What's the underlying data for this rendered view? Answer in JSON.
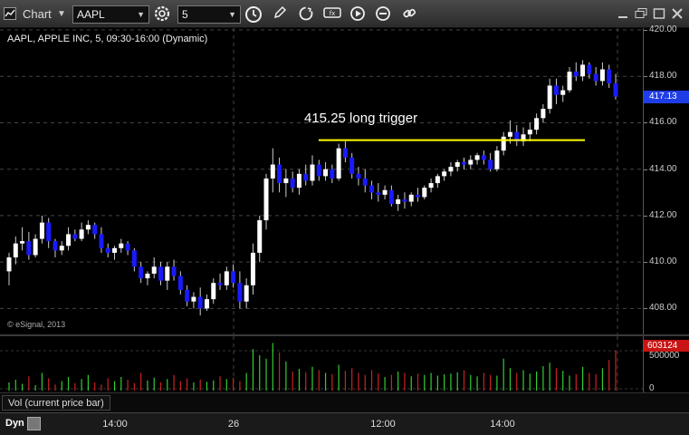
{
  "toolbar": {
    "app_title": "Chart",
    "symbol": "AAPL",
    "interval": "5"
  },
  "chart": {
    "symbol_title": "AAPL, APPLE INC, 5, 09:30-16:00 (Dynamic)",
    "copyright": "© eSignal, 2013",
    "annotation": "415.25 long trigger",
    "trigger_price": 415.25,
    "last_price": "417.13",
    "price_ticks": [
      "420.00",
      "418.00",
      "416.00",
      "414.00",
      "412.00",
      "410.00",
      "408.00"
    ],
    "colors": {
      "up": "#ffffff",
      "down": "#1a1aff",
      "trigger": "#ffff00",
      "wick": "#cccccc"
    },
    "candles": [
      [
        409.6,
        410.4,
        409.0,
        410.2
      ],
      [
        410.2,
        411.1,
        409.9,
        410.8
      ],
      [
        410.8,
        411.5,
        410.5,
        410.9
      ],
      [
        410.9,
        411.3,
        410.1,
        410.3
      ],
      [
        410.3,
        411.2,
        410.2,
        411.0
      ],
      [
        411.0,
        412.0,
        410.8,
        411.7
      ],
      [
        411.7,
        411.9,
        410.6,
        410.9
      ],
      [
        410.9,
        411.0,
        410.2,
        410.5
      ],
      [
        410.5,
        410.9,
        410.3,
        410.7
      ],
      [
        410.7,
        411.5,
        410.5,
        411.2
      ],
      [
        411.2,
        411.4,
        410.9,
        411.0
      ],
      [
        411.0,
        411.7,
        410.9,
        411.4
      ],
      [
        411.4,
        411.8,
        411.2,
        411.6
      ],
      [
        411.6,
        411.7,
        411.0,
        411.2
      ],
      [
        411.2,
        411.5,
        410.4,
        410.6
      ],
      [
        410.6,
        410.8,
        410.2,
        410.4
      ],
      [
        410.4,
        410.7,
        410.1,
        410.6
      ],
      [
        410.6,
        411.0,
        410.4,
        410.8
      ],
      [
        410.8,
        410.9,
        410.3,
        410.5
      ],
      [
        410.5,
        410.6,
        409.6,
        409.8
      ],
      [
        409.8,
        410.0,
        409.1,
        409.3
      ],
      [
        409.3,
        409.6,
        409.0,
        409.5
      ],
      [
        409.5,
        410.2,
        409.3,
        409.8
      ],
      [
        409.8,
        410.0,
        409.0,
        409.2
      ],
      [
        409.2,
        410.0,
        408.8,
        409.8
      ],
      [
        409.8,
        410.1,
        409.2,
        409.4
      ],
      [
        409.4,
        409.6,
        408.6,
        408.8
      ],
      [
        408.8,
        409.0,
        408.1,
        408.3
      ],
      [
        408.3,
        408.7,
        408.0,
        408.5
      ],
      [
        408.5,
        408.9,
        407.7,
        408.0
      ],
      [
        408.0,
        408.6,
        407.9,
        408.4
      ],
      [
        408.4,
        409.3,
        408.2,
        409.1
      ],
      [
        409.1,
        409.5,
        408.8,
        409.0
      ],
      [
        409.0,
        409.8,
        408.8,
        409.6
      ],
      [
        409.6,
        409.9,
        408.9,
        409.1
      ],
      [
        409.1,
        409.6,
        408.0,
        408.3
      ],
      [
        408.3,
        409.3,
        408.0,
        409.0
      ],
      [
        409.0,
        410.8,
        408.6,
        410.4
      ],
      [
        410.4,
        412.0,
        410.0,
        411.8
      ],
      [
        411.8,
        413.8,
        411.4,
        413.6
      ],
      [
        413.6,
        414.9,
        413.0,
        414.2
      ],
      [
        414.2,
        414.5,
        413.0,
        413.4
      ],
      [
        413.4,
        414.0,
        412.8,
        413.6
      ],
      [
        413.6,
        413.9,
        413.0,
        413.2
      ],
      [
        413.2,
        414.0,
        412.9,
        413.8
      ],
      [
        413.8,
        414.2,
        413.3,
        413.5
      ],
      [
        413.5,
        414.6,
        413.3,
        414.2
      ],
      [
        414.2,
        414.4,
        413.5,
        413.7
      ],
      [
        413.7,
        414.3,
        413.5,
        414.0
      ],
      [
        414.0,
        414.2,
        413.4,
        413.6
      ],
      [
        413.6,
        415.1,
        413.5,
        414.9
      ],
      [
        414.9,
        415.2,
        414.3,
        414.5
      ],
      [
        414.5,
        414.7,
        413.6,
        413.8
      ],
      [
        413.8,
        414.1,
        413.3,
        413.6
      ],
      [
        413.6,
        414.0,
        413.0,
        413.3
      ],
      [
        413.3,
        413.5,
        412.7,
        413.0
      ],
      [
        413.0,
        413.4,
        412.6,
        412.9
      ],
      [
        412.9,
        413.3,
        412.7,
        413.1
      ],
      [
        413.1,
        413.3,
        412.4,
        412.5
      ],
      [
        412.5,
        412.9,
        412.2,
        412.7
      ],
      [
        412.7,
        413.0,
        412.3,
        412.6
      ],
      [
        412.6,
        413.0,
        412.4,
        412.9
      ],
      [
        412.9,
        413.2,
        412.6,
        412.8
      ],
      [
        412.8,
        413.3,
        412.7,
        413.2
      ],
      [
        413.2,
        413.6,
        413.0,
        413.4
      ],
      [
        413.4,
        413.8,
        413.2,
        413.7
      ],
      [
        413.7,
        414.0,
        413.5,
        413.9
      ],
      [
        413.9,
        414.3,
        413.7,
        414.1
      ],
      [
        414.1,
        414.4,
        413.9,
        414.3
      ],
      [
        414.3,
        414.5,
        414.0,
        414.2
      ],
      [
        414.2,
        414.6,
        414.0,
        414.4
      ],
      [
        414.4,
        414.7,
        414.2,
        414.6
      ],
      [
        414.6,
        414.8,
        414.2,
        414.4
      ],
      [
        414.4,
        414.7,
        413.9,
        414.0
      ],
      [
        414.0,
        415.0,
        413.9,
        414.8
      ],
      [
        414.8,
        415.6,
        414.6,
        415.4
      ],
      [
        415.4,
        416.1,
        415.1,
        415.6
      ],
      [
        415.6,
        415.9,
        415.0,
        415.2
      ],
      [
        415.2,
        415.8,
        415.0,
        415.5
      ],
      [
        415.5,
        416.0,
        415.2,
        415.7
      ],
      [
        415.7,
        416.4,
        415.5,
        416.2
      ],
      [
        416.2,
        416.8,
        416.0,
        416.6
      ],
      [
        416.6,
        417.9,
        416.4,
        417.6
      ],
      [
        417.6,
        417.9,
        416.8,
        417.2
      ],
      [
        417.2,
        417.6,
        416.9,
        417.4
      ],
      [
        417.4,
        418.4,
        417.3,
        418.2
      ],
      [
        418.2,
        418.6,
        417.8,
        418.0
      ],
      [
        418.0,
        418.7,
        417.8,
        418.5
      ],
      [
        418.5,
        418.6,
        417.9,
        418.1
      ],
      [
        418.1,
        418.4,
        417.6,
        417.8
      ],
      [
        417.8,
        418.6,
        417.6,
        418.3
      ],
      [
        418.3,
        418.5,
        417.5,
        417.7
      ],
      [
        417.7,
        418.1,
        417.0,
        417.13
      ]
    ]
  },
  "volume": {
    "label": "Vol (current price bar)",
    "current": "603124",
    "ticks": [
      "500000",
      "0"
    ],
    "values": [
      120,
      160,
      100,
      210,
      80,
      260,
      180,
      90,
      140,
      200,
      110,
      170,
      230,
      120,
      90,
      180,
      140,
      200,
      160,
      110,
      260,
      150,
      190,
      120,
      170,
      230,
      140,
      180,
      120,
      160,
      130,
      150,
      210,
      170,
      190,
      140,
      260,
      610,
      520,
      470,
      700,
      560,
      430,
      280,
      320,
      270,
      350,
      300,
      260,
      240,
      380,
      290,
      330,
      260,
      230,
      300,
      250,
      200,
      230,
      280,
      260,
      210,
      250,
      230,
      260,
      220,
      240,
      250,
      270,
      300,
      230,
      210,
      260,
      230,
      220,
      470,
      330,
      260,
      300,
      250,
      280,
      360,
      410,
      330,
      290,
      220,
      240,
      350,
      260,
      240,
      330,
      450,
      590
    ],
    "colors": {
      "up": "#33cc33",
      "down": "#cc2222"
    }
  },
  "time_axis": {
    "labels": [
      "14:00",
      "26",
      "12:00",
      "14:00"
    ]
  },
  "bottom": {
    "dyn": "Dyn"
  }
}
